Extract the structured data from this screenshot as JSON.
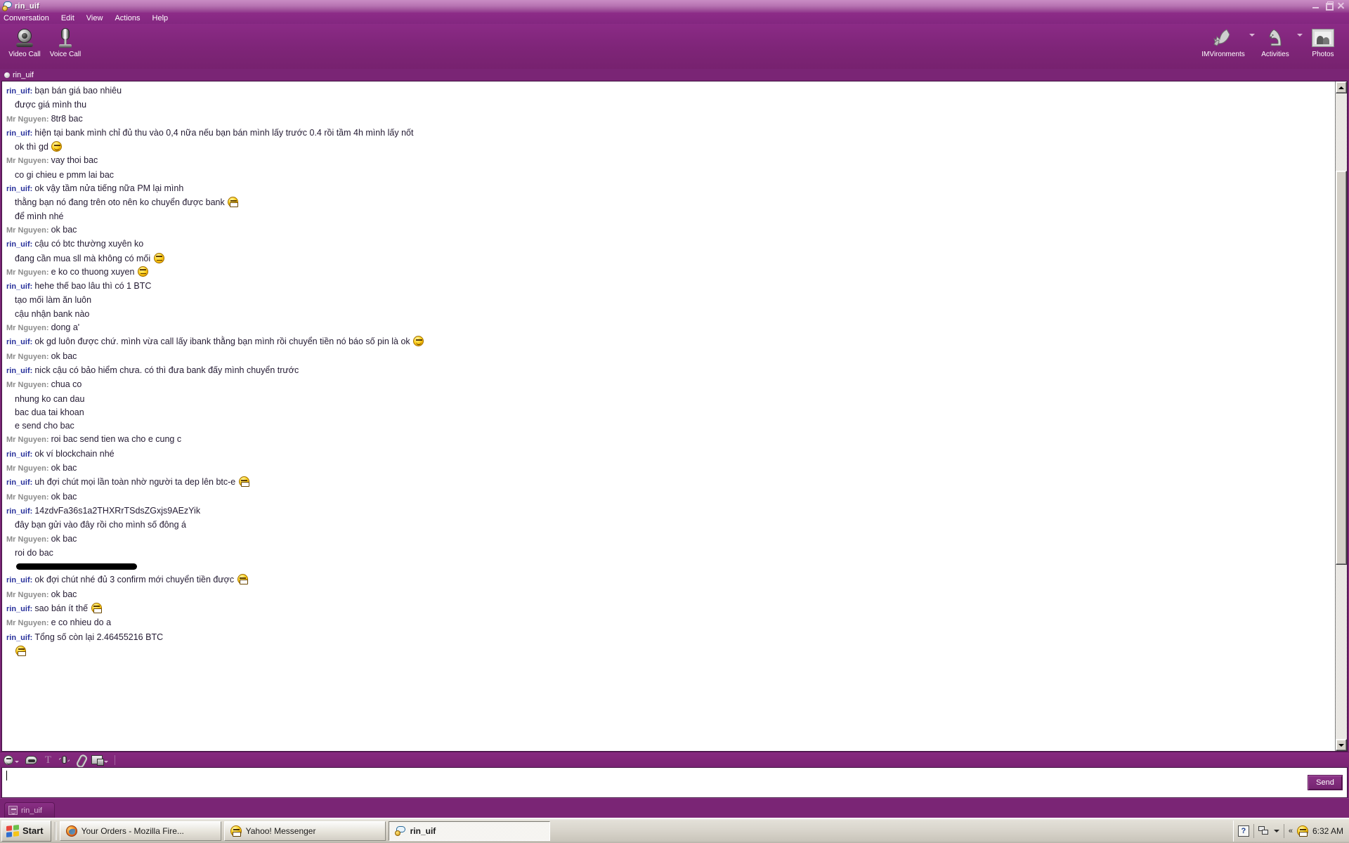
{
  "window": {
    "title": "rin_uif",
    "logo_icon": "yahoo-messenger-icon",
    "buttons": {
      "minimize": "minimize-icon",
      "restore": "restore-icon",
      "close": "close-icon"
    }
  },
  "menubar": {
    "items": [
      {
        "label": "Conversation"
      },
      {
        "label": "Edit"
      },
      {
        "label": "View"
      },
      {
        "label": "Actions"
      },
      {
        "label": "Help"
      }
    ]
  },
  "toolbar": {
    "left": [
      {
        "label": "Video Call",
        "icon": "webcam-icon"
      },
      {
        "label": "Voice Call",
        "icon": "microphone-icon"
      }
    ],
    "right": [
      {
        "label": "IMVironments",
        "icon": "leaf-icon",
        "has_caret": true
      },
      {
        "label": "Activities",
        "icon": "chess-knight-icon",
        "has_caret": true
      },
      {
        "label": "Photos",
        "icon": "photo-frame-icon",
        "has_caret": false
      }
    ]
  },
  "contact": {
    "name": "rin_uif",
    "presence_icon": "presence-dot-icon"
  },
  "chat": {
    "me_name": "rin_uif",
    "them_name": "Mr Nguyen",
    "messages": [
      {
        "who": "rin_uif",
        "side": "me",
        "text": "bạn bán giá bao nhiêu"
      },
      {
        "who": "",
        "side": "cont",
        "text": "được giá mình thu"
      },
      {
        "who": "Mr Nguyen",
        "side": "them",
        "text": "8tr8 bac"
      },
      {
        "who": "rin_uif",
        "side": "me",
        "text": "hiện tại bank mình chỉ đủ thu vào 0,4 nữa nếu bạn bán mình lấy trước 0.4 rồi tầm 4h mình lấy nốt"
      },
      {
        "who": "",
        "side": "cont",
        "text": "ok thì gd ",
        "emoji": "smile"
      },
      {
        "who": "Mr Nguyen",
        "side": "them",
        "text": "vay thoi bac"
      },
      {
        "who": "",
        "side": "cont",
        "text": "co gi chieu e pmm lai bac"
      },
      {
        "who": "rin_uif",
        "side": "me",
        "text": "ok vậy tầm nửa tiếng nữa PM lại mình"
      },
      {
        "who": "",
        "side": "cont",
        "text": "thằng bạn nó đang trên oto nên ko chuyển được bank ",
        "emoji": "grin"
      },
      {
        "who": "",
        "side": "cont",
        "text": "để mình nhé"
      },
      {
        "who": "Mr Nguyen",
        "side": "them",
        "text": "ok bac"
      },
      {
        "who": "rin_uif",
        "side": "me",
        "text": "cậu có btc thường xuyên ko"
      },
      {
        "who": "",
        "side": "cont",
        "text": "đang cần mua sll mà không có mối ",
        "emoji": "flat"
      },
      {
        "who": "Mr Nguyen",
        "side": "them",
        "text": "e ko co thuong xuyen ",
        "emoji": "flat"
      },
      {
        "who": "rin_uif",
        "side": "me",
        "text": "hehe thế bao lâu thì có 1 BTC"
      },
      {
        "who": "",
        "side": "cont",
        "text": "tạo mối làm ăn luôn"
      },
      {
        "who": "",
        "side": "cont",
        "text": "cậu nhận bank nào"
      },
      {
        "who": "Mr Nguyen",
        "side": "them",
        "text": "dong a'"
      },
      {
        "who": "rin_uif",
        "side": "me",
        "text": "ok gd luôn được chứ. mình vừa call lấy ibank thằng bạn mình rồi chuyển tiền nó báo số pin là ok ",
        "emoji": "smile"
      },
      {
        "who": "Mr Nguyen",
        "side": "them",
        "text": "ok bac"
      },
      {
        "who": "rin_uif",
        "side": "me",
        "text": "nick cậu có bảo hiểm chưa. có thì đưa bank đấy mình chuyển trước"
      },
      {
        "who": "Mr Nguyen",
        "side": "them",
        "text": "chua co"
      },
      {
        "who": "",
        "side": "cont",
        "text": "nhung ko can dau"
      },
      {
        "who": "",
        "side": "cont",
        "text": "bac dua tai khoan"
      },
      {
        "who": "",
        "side": "cont",
        "text": "e send cho bac"
      },
      {
        "who": "Mr Nguyen",
        "side": "them",
        "text": "roi bac send tien wa cho e cung c"
      },
      {
        "who": "rin_uif",
        "side": "me",
        "text": "ok ví blockchain nhé"
      },
      {
        "who": "Mr Nguyen",
        "side": "them",
        "text": "ok bac"
      },
      {
        "who": "rin_uif",
        "side": "me",
        "text": "uh đợi chút mọi lần toàn nhờ người ta dep lên btc-e ",
        "emoji": "grin"
      },
      {
        "who": "Mr Nguyen",
        "side": "them",
        "text": "ok bac"
      },
      {
        "who": "rin_uif",
        "side": "me",
        "text": "14zdvFa36s1a2THXRrTSdsZGxjs9AEzYik"
      },
      {
        "who": "",
        "side": "cont",
        "text": "đây bạn gửi vào đây rồi cho mình số đông á"
      },
      {
        "who": "Mr Nguyen",
        "side": "them",
        "text": "ok bac"
      },
      {
        "who": "",
        "side": "cont",
        "text": "roi do bac"
      },
      {
        "who": "",
        "side": "cont",
        "text": "",
        "redacted": true
      },
      {
        "who": "rin_uif",
        "side": "me",
        "text": "ok đợi chút nhé đủ 3 confirm mới chuyển tiền được ",
        "emoji": "grin"
      },
      {
        "who": "Mr Nguyen",
        "side": "them",
        "text": "ok bac"
      },
      {
        "who": "rin_uif",
        "side": "me",
        "text": "sao bán ít thế ",
        "emoji": "grin"
      },
      {
        "who": "Mr Nguyen",
        "side": "them",
        "text": "e co nhieu do a"
      },
      {
        "who": "rin_uif",
        "side": "me",
        "text": "Tổng số còn lại 2.46455216 BTC"
      },
      {
        "who": "",
        "side": "cont",
        "text": "",
        "emoji": "grin"
      }
    ]
  },
  "compose_toolbar": {
    "buttons": [
      {
        "icon": "emoticon-icon",
        "has_caret": true
      },
      {
        "icon": "ims-bubble-icon",
        "has_caret": false
      },
      {
        "icon": "text-format-icon",
        "has_caret": false
      },
      {
        "icon": "buzz-icon",
        "has_caret": false
      },
      {
        "icon": "attach-file-icon",
        "has_caret": false
      },
      {
        "icon": "send-screenshot-icon",
        "has_caret": true
      }
    ]
  },
  "compose": {
    "value": "",
    "placeholder": "",
    "send_label": "Send"
  },
  "window_tabs": [
    {
      "label": "rin_uif",
      "icon": "conversation-tab-icon",
      "active": true
    }
  ],
  "taskbar": {
    "start_label": "Start",
    "tasks": [
      {
        "label": "Your Orders - Mozilla Fire...",
        "icon": "firefox-icon",
        "active": false
      },
      {
        "label": "Yahoo! Messenger",
        "icon": "yahoo-messenger-smiley-icon",
        "active": false
      },
      {
        "label": "rin_uif",
        "icon": "conversation-window-icon",
        "active": true
      }
    ],
    "tray": {
      "icons": [
        "help-icon",
        "network-connections-icon"
      ],
      "expand_label": "«",
      "messenger_icon": "yahoo-messenger-tray-icon",
      "clock": "6:32 AM"
    }
  },
  "colors": {
    "chrome_purple": "#7a2575",
    "titlebar_light": "#c98cc4",
    "me_name": "#27309b",
    "them_name": "#8b8b8b",
    "chat_bg": "#ffffff",
    "taskbar_gray": "#d8d4cb"
  }
}
